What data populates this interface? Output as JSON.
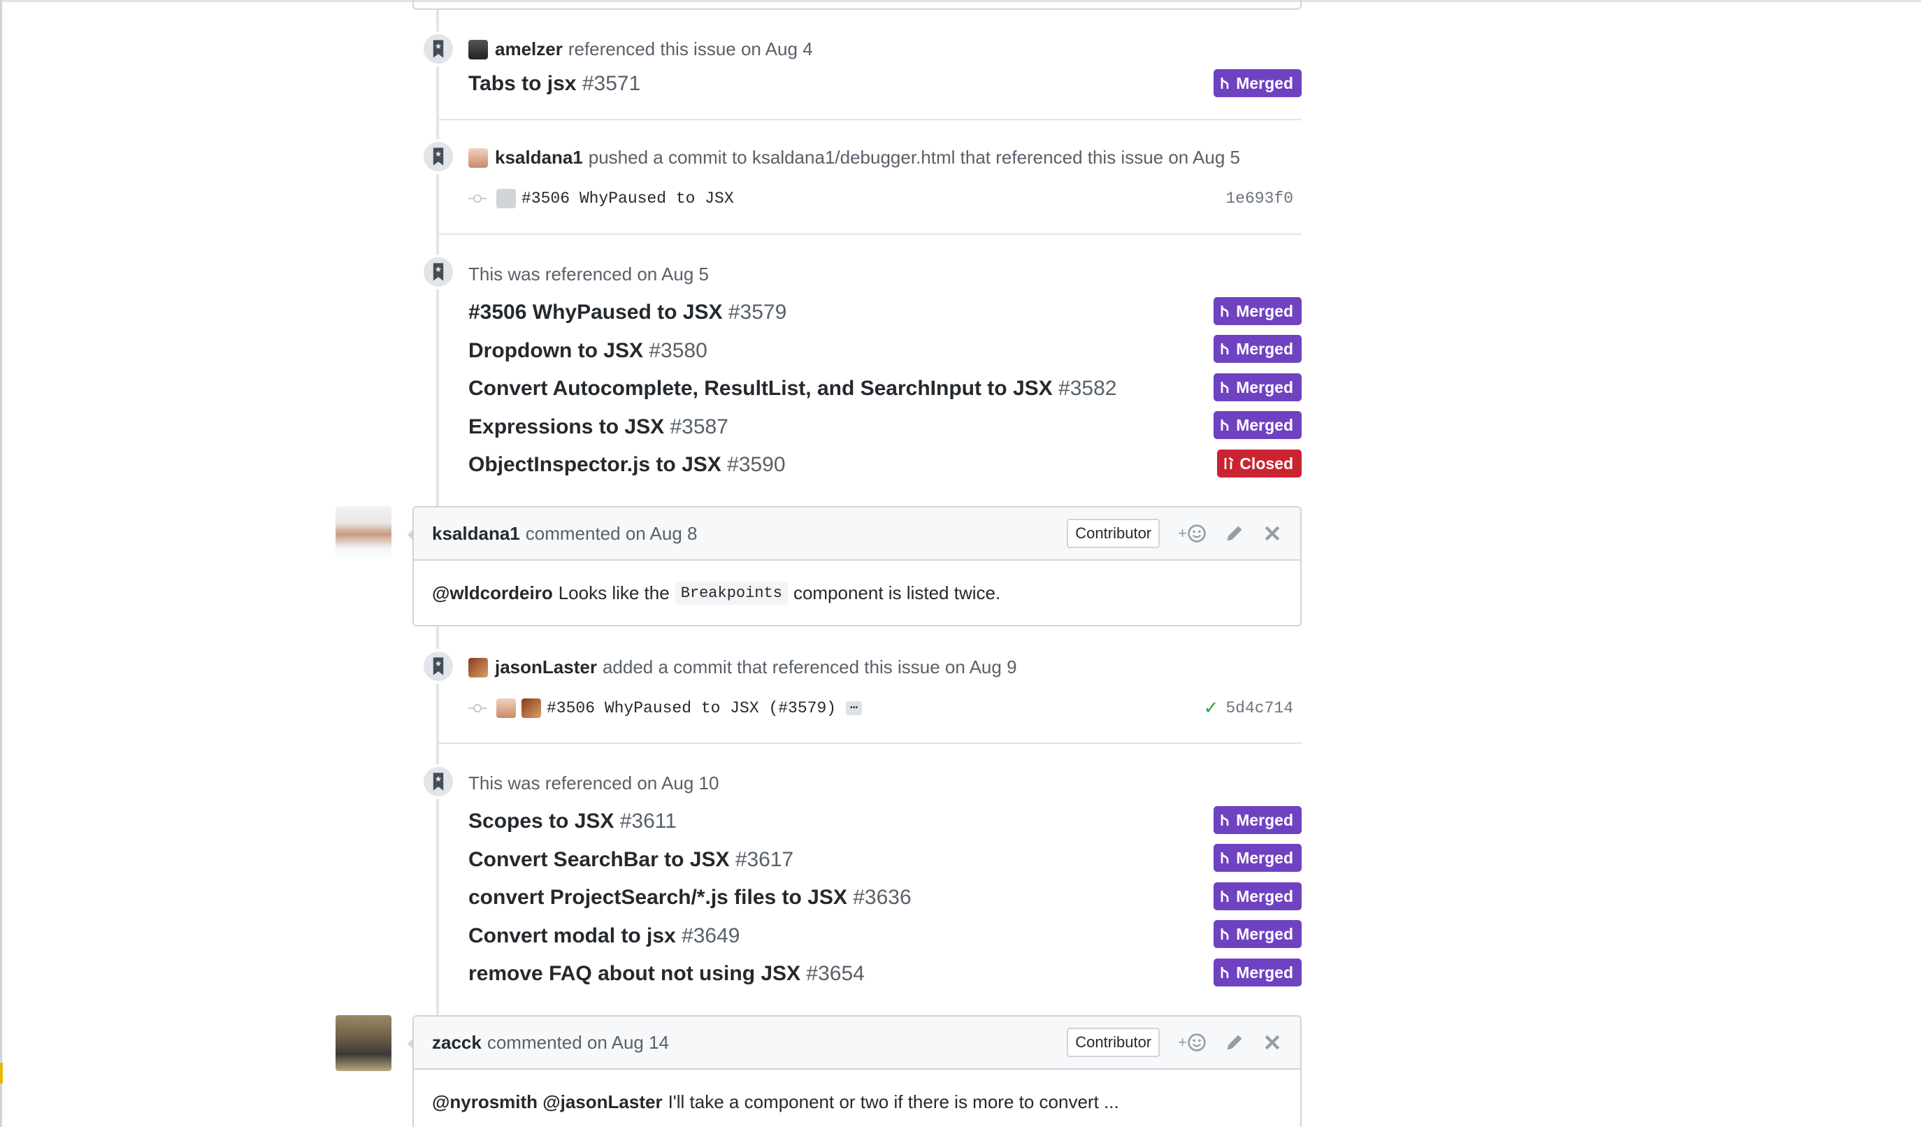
{
  "events": {
    "amelzer": {
      "author": "amelzer",
      "text": "referenced this issue on Aug 4",
      "pr_title": "Tabs to jsx",
      "pr_number": "#3571",
      "state": "Merged"
    },
    "ksaldana_push": {
      "author": "ksaldana1",
      "text": "pushed a commit to ksaldana1/debugger.html that referenced this issue on Aug 5",
      "commit_message": "#3506 WhyPaused to JSX",
      "commit_sha": "1e693f0"
    },
    "ref_aug5": {
      "text": "This was referenced on Aug 5",
      "items": [
        {
          "title": "#3506 WhyPaused to JSX",
          "number": "#3579",
          "state": "Merged"
        },
        {
          "title": "Dropdown to JSX",
          "number": "#3580",
          "state": "Merged"
        },
        {
          "title": "Convert Autocomplete, ResultList, and SearchInput to JSX",
          "number": "#3582",
          "state": "Merged"
        },
        {
          "title": "Expressions to JSX",
          "number": "#3587",
          "state": "Merged"
        },
        {
          "title": "ObjectInspector.js to JSX",
          "number": "#3590",
          "state": "Closed"
        }
      ]
    },
    "comment1": {
      "author": "ksaldana1",
      "meta": "commented on Aug 8",
      "role": "Contributor",
      "reaction": "+",
      "mention": "@wldcordeiro",
      "body_before": "Looks like the",
      "code": "Breakpoints",
      "body_after": "component is listed twice."
    },
    "jasonlaster_commit": {
      "author": "jasonLaster",
      "text": "added a commit that referenced this issue on Aug 9",
      "commit_message": "#3506 WhyPaused to JSX (#3579)",
      "ellipsis": "…",
      "commit_sha": "5d4c714",
      "check": "✓"
    },
    "ref_aug10": {
      "text": "This was referenced on Aug 10",
      "items": [
        {
          "title": "Scopes to JSX",
          "number": "#3611",
          "state": "Merged"
        },
        {
          "title": "Convert SearchBar to JSX",
          "number": "#3617",
          "state": "Merged"
        },
        {
          "title": "convert ProjectSearch/*.js files to JSX",
          "number": "#3636",
          "state": "Merged"
        },
        {
          "title": "Convert modal to jsx",
          "number": "#3649",
          "state": "Merged"
        },
        {
          "title": "remove FAQ about not using JSX",
          "number": "#3654",
          "state": "Merged"
        }
      ]
    },
    "comment2": {
      "author": "zacck",
      "meta": "commented on Aug 14",
      "role": "Contributor",
      "reaction": "+",
      "mentions": "@nyrosmith @jasonLaster",
      "body": "I'll take a component or two if there is more to convert ..."
    }
  },
  "colors": {
    "merged": "#6f42c1",
    "closed": "#cb2431",
    "timeline": "#e1e4e8",
    "link": "#24292e",
    "muted": "#586069"
  }
}
